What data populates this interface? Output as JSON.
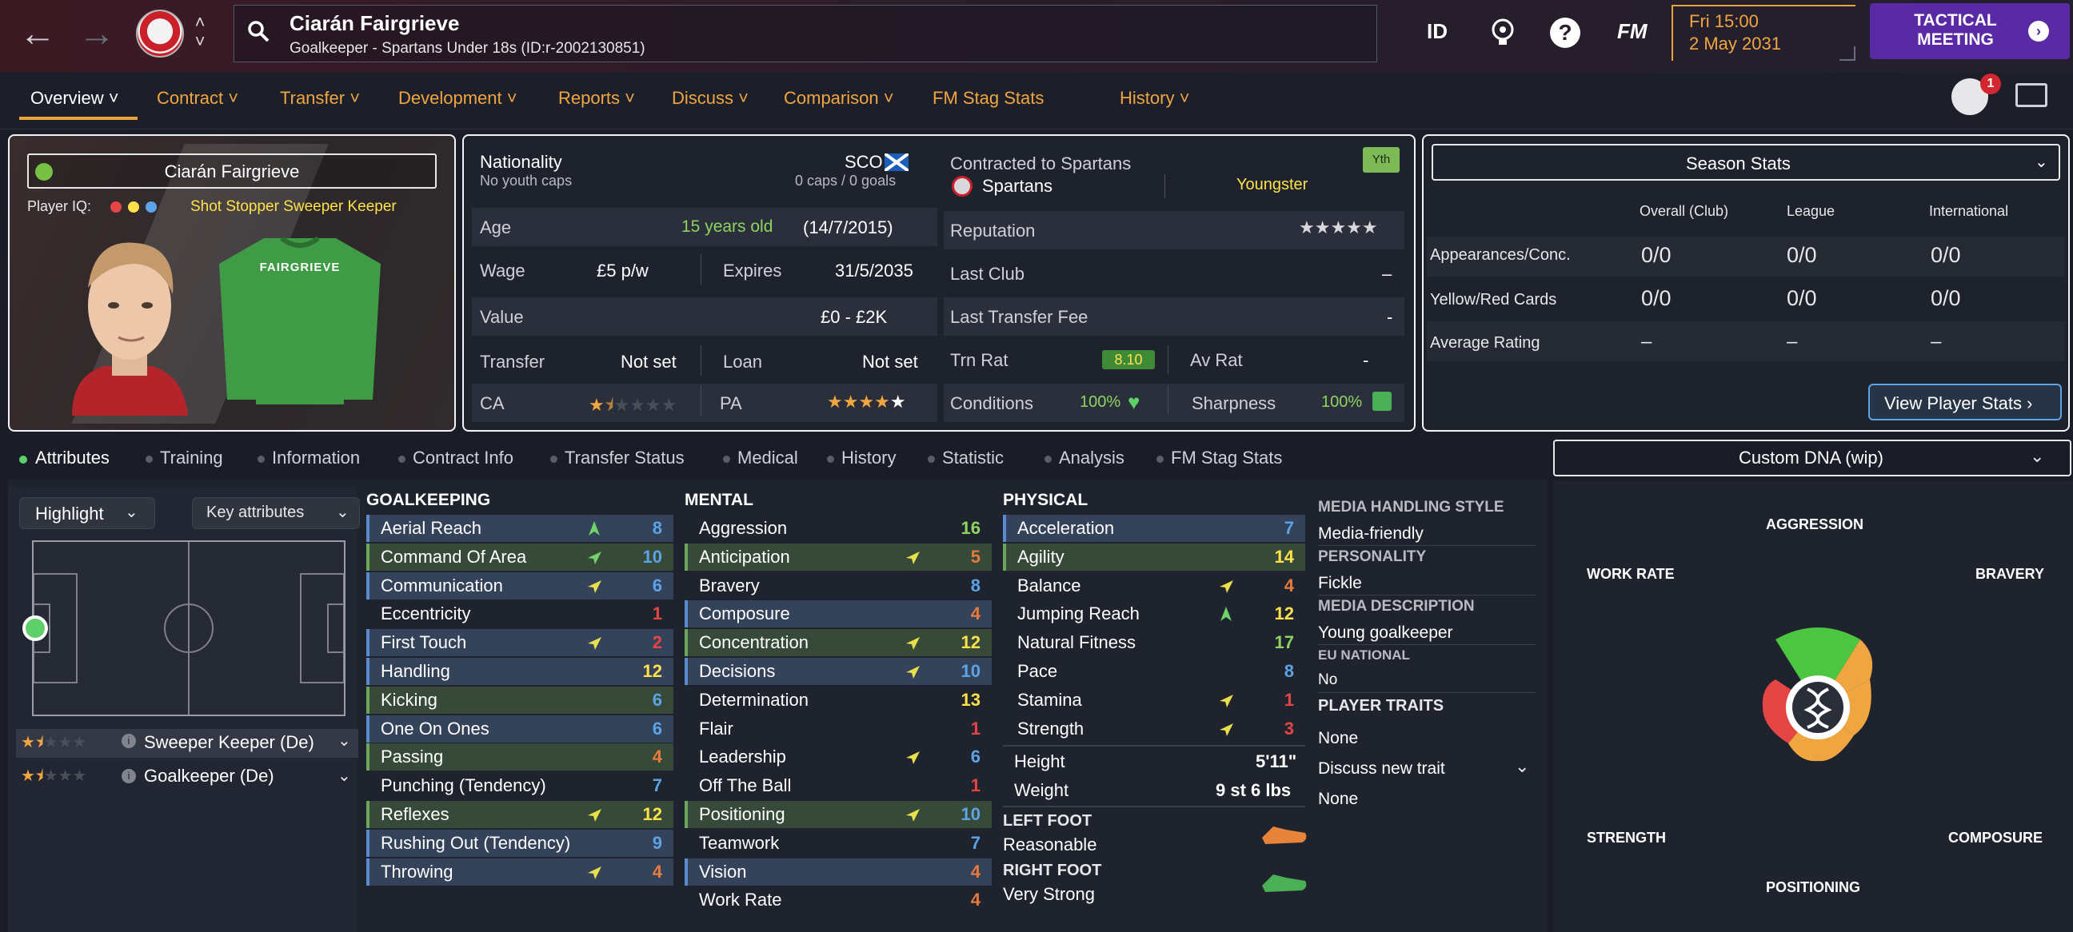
{
  "header": {
    "player_name": "Ciarán Fairgrieve",
    "subtitle": "Goalkeeper - Spartans Under 18s (ID:r-2002130851)",
    "id_label": "ID",
    "fm_label": "FM",
    "help_label": "?",
    "date_day": "Fri 15:00",
    "date_full": "2 May 2031",
    "tactical_label": "TACTICAL MEETING",
    "notification_count": "1"
  },
  "nav": {
    "tabs": [
      "Overview",
      "Contract",
      "Transfer",
      "Development",
      "Reports",
      "Discuss",
      "Comparison",
      "FM Stag Stats",
      "History"
    ]
  },
  "card": {
    "name": "Ciarán Fairgrieve",
    "iq_label": "Player IQ:",
    "roles": "Shot Stopper  Sweeper Keeper",
    "shirt_name": "FAIRGRIEVE"
  },
  "info": {
    "nationality_label": "Nationality",
    "nationality_sub": "No youth caps",
    "nation_code": "SCO",
    "caps": "0 caps / 0 goals",
    "contracted_label": "Contracted to Spartans",
    "club": "Spartans",
    "status": "Youngster",
    "yth_badge": "Yth",
    "age_label": "Age",
    "age_value": "15 years old",
    "dob": "(14/7/2015)",
    "reputation_label": "Reputation",
    "wage_label": "Wage",
    "wage_value": "£5 p/w",
    "expires_label": "Expires",
    "expires_value": "31/5/2035",
    "last_club_label": "Last Club",
    "last_club_value": "–",
    "value_label": "Value",
    "value_value": "£0 - £2K",
    "last_fee_label": "Last Transfer Fee",
    "last_fee_value": "-",
    "transfer_label": "Transfer",
    "transfer_value": "Not set",
    "loan_label": "Loan",
    "loan_value": "Not set",
    "trn_label": "Trn Rat",
    "trn_value": "8.10",
    "av_label": "Av Rat",
    "av_value": "-",
    "ca_label": "CA",
    "pa_label": "PA",
    "conditions_label": "Conditions",
    "conditions_value": "100%",
    "sharpness_label": "Sharpness",
    "sharpness_value": "100%",
    "ca_stars": 1.5,
    "pa_stars": 4.5,
    "reputation_stars": 5
  },
  "season": {
    "title": "Season Stats",
    "cols": [
      "Overall (Club)",
      "League",
      "International"
    ],
    "rows": [
      {
        "label": "Appearances/Conc.",
        "vals": [
          "0/0",
          "0/0",
          "0/0"
        ]
      },
      {
        "label": "Yellow/Red Cards",
        "vals": [
          "0/0",
          "0/0",
          "0/0"
        ]
      },
      {
        "label": "Average Rating",
        "vals": [
          "–",
          "–",
          "–"
        ]
      }
    ],
    "view_button": "View Player Stats ›"
  },
  "subtabs": [
    "Attributes",
    "Training",
    "Information",
    "Contract Info",
    "Transfer Status",
    "Medical",
    "History",
    "Statistic",
    "Analysis",
    "FM Stag Stats"
  ],
  "pitch": {
    "highlight": "Highlight",
    "key_attributes": "Key attributes",
    "roles": [
      {
        "name": "Sweeper Keeper (De)",
        "stars": 1.5
      },
      {
        "name": "Goalkeeper (De)",
        "stars": 1.5
      }
    ]
  },
  "attributes": {
    "goalkeeping_title": "GOALKEEPING",
    "mental_title": "MENTAL",
    "physical_title": "PHYSICAL",
    "goalkeeping": [
      {
        "name": "Aerial Reach",
        "value": "8",
        "hl": "hl",
        "arrow": "up-green"
      },
      {
        "name": "Command Of Area",
        "value": "10",
        "hl": "hlg",
        "arrow": "side-green"
      },
      {
        "name": "Communication",
        "value": "6",
        "hl": "hl",
        "arrow": "side-yellow"
      },
      {
        "name": "Eccentricity",
        "value": "1",
        "hl": "plain",
        "arrow": ""
      },
      {
        "name": "First Touch",
        "value": "2",
        "hl": "hl",
        "arrow": "side-yellow"
      },
      {
        "name": "Handling",
        "value": "12",
        "hl": "hl",
        "arrow": ""
      },
      {
        "name": "Kicking",
        "value": "6",
        "hl": "hlg",
        "arrow": ""
      },
      {
        "name": "One On Ones",
        "value": "6",
        "hl": "hl",
        "arrow": ""
      },
      {
        "name": "Passing",
        "value": "4",
        "hl": "hlg",
        "arrow": ""
      },
      {
        "name": "Punching (Tendency)",
        "value": "7",
        "hl": "plain",
        "arrow": ""
      },
      {
        "name": "Reflexes",
        "value": "12",
        "hl": "hlg",
        "arrow": "side-yellow"
      },
      {
        "name": "Rushing Out (Tendency)",
        "value": "9",
        "hl": "hl",
        "arrow": ""
      },
      {
        "name": "Throwing",
        "value": "4",
        "hl": "hl",
        "arrow": "side-yellow"
      }
    ],
    "mental": [
      {
        "name": "Aggression",
        "value": "16",
        "hl": "plain",
        "arrow": ""
      },
      {
        "name": "Anticipation",
        "value": "5",
        "hl": "hlg",
        "arrow": "side-yellow"
      },
      {
        "name": "Bravery",
        "value": "8",
        "hl": "plain",
        "arrow": ""
      },
      {
        "name": "Composure",
        "value": "4",
        "hl": "hl",
        "arrow": ""
      },
      {
        "name": "Concentration",
        "value": "12",
        "hl": "hlg",
        "arrow": "side-yellow"
      },
      {
        "name": "Decisions",
        "value": "10",
        "hl": "hl",
        "arrow": "side-yellow"
      },
      {
        "name": "Determination",
        "value": "13",
        "hl": "plain",
        "arrow": ""
      },
      {
        "name": "Flair",
        "value": "1",
        "hl": "plain",
        "arrow": ""
      },
      {
        "name": "Leadership",
        "value": "6",
        "hl": "plain",
        "arrow": "side-yellow"
      },
      {
        "name": "Off The Ball",
        "value": "1",
        "hl": "plain",
        "arrow": ""
      },
      {
        "name": "Positioning",
        "value": "10",
        "hl": "hlg",
        "arrow": "side-yellow"
      },
      {
        "name": "Teamwork",
        "value": "7",
        "hl": "plain",
        "arrow": ""
      },
      {
        "name": "Vision",
        "value": "4",
        "hl": "hl",
        "arrow": ""
      },
      {
        "name": "Work Rate",
        "value": "4",
        "hl": "plain",
        "arrow": ""
      }
    ],
    "physical": [
      {
        "name": "Acceleration",
        "value": "7",
        "hl": "hl",
        "arrow": ""
      },
      {
        "name": "Agility",
        "value": "14",
        "hl": "hlg",
        "arrow": ""
      },
      {
        "name": "Balance",
        "value": "4",
        "hl": "plain",
        "arrow": "side-yellow"
      },
      {
        "name": "Jumping Reach",
        "value": "12",
        "hl": "plain",
        "arrow": "up-green"
      },
      {
        "name": "Natural Fitness",
        "value": "17",
        "hl": "plain",
        "arrow": ""
      },
      {
        "name": "Pace",
        "value": "8",
        "hl": "plain",
        "arrow": ""
      },
      {
        "name": "Stamina",
        "value": "1",
        "hl": "plain",
        "arrow": "side-yellow"
      },
      {
        "name": "Strength",
        "value": "3",
        "hl": "plain",
        "arrow": "side-yellow"
      }
    ],
    "height_label": "Height",
    "height_value": "5'11\"",
    "weight_label": "Weight",
    "weight_value": "9 st 6 lbs",
    "left_foot_label": "LEFT FOOT",
    "left_foot_value": "Reasonable",
    "right_foot_label": "RIGHT FOOT",
    "right_foot_value": "Very Strong"
  },
  "facts": {
    "media_style_label": "MEDIA HANDLING STYLE",
    "media_style_value": "Media-friendly",
    "personality_label": "PERSONALITY",
    "personality_value": "Fickle",
    "media_desc_label": "MEDIA DESCRIPTION",
    "media_desc_value": "Young goalkeeper",
    "eu_label": "EU NATIONAL",
    "eu_value": "No",
    "traits_label": "PLAYER TRAITS",
    "traits_value": "None",
    "discuss_label": "Discuss new trait",
    "discuss_value": "None"
  },
  "dna": {
    "title": "Custom DNA (wip)",
    "labels": {
      "top": "AGGRESSION",
      "work_rate": "WORK RATE",
      "bravery": "BRAVERY",
      "strength": "STRENGTH",
      "composure": "COMPOSURE",
      "bottom": "POSITIONING"
    }
  },
  "colors": {
    "accent": "#e8a33b",
    "button": "#5a2aa4",
    "good": "#8fd460",
    "bad": "#e64545"
  }
}
